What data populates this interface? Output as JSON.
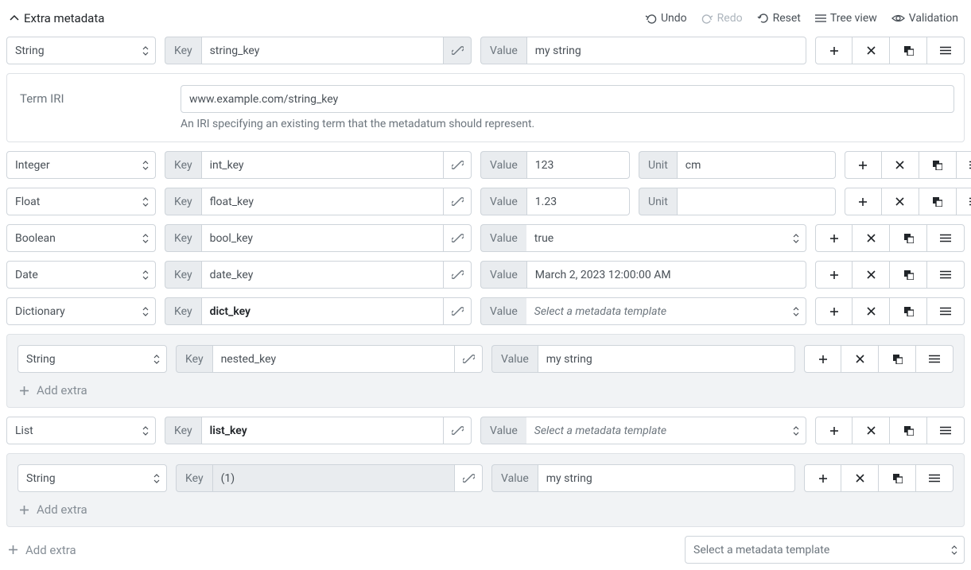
{
  "header": {
    "title": "Extra metadata"
  },
  "toolbar": {
    "undo": "Undo",
    "redo": "Redo",
    "reset": "Reset",
    "tree_view": "Tree view",
    "validation": "Validation"
  },
  "labels": {
    "key": "Key",
    "value": "Value",
    "unit": "Unit",
    "term_iri": "Term IRI",
    "add_extra": "Add extra",
    "select_template": "Select a metadata template"
  },
  "iri_panel": {
    "value": "www.example.com/string_key",
    "help": "An IRI specifying an existing term that the metadatum should represent."
  },
  "rows": {
    "string": {
      "type": "String",
      "key": "string_key",
      "value": "my string",
      "link_active": true
    },
    "integer": {
      "type": "Integer",
      "key": "int_key",
      "value": "123",
      "unit": "cm"
    },
    "float": {
      "type": "Float",
      "key": "float_key",
      "value": "1.23",
      "unit": ""
    },
    "boolean": {
      "type": "Boolean",
      "key": "bool_key",
      "value": "true"
    },
    "date": {
      "type": "Date",
      "key": "date_key",
      "value": "March 2, 2023 12:00:00 AM"
    },
    "dictionary": {
      "type": "Dictionary",
      "key": "dict_key"
    },
    "dict_nested": {
      "type": "String",
      "key": "nested_key",
      "value": "my string"
    },
    "list": {
      "type": "List",
      "key": "list_key"
    },
    "list_nested": {
      "type": "String",
      "key": "(1)",
      "value": "my string"
    }
  }
}
